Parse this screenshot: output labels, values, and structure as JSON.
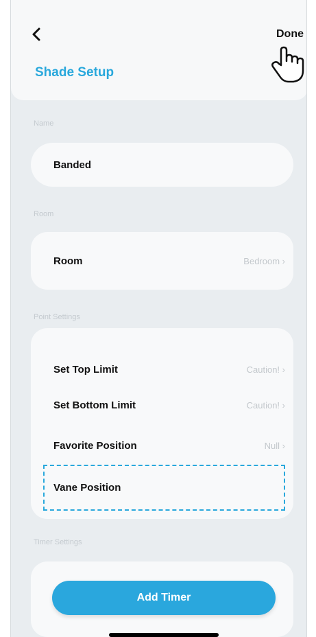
{
  "header": {
    "title": "Shade Setup",
    "done_label": "Done"
  },
  "sections": {
    "name_label": "Name",
    "room_label": "Room",
    "point_settings_label": "Point Settings",
    "timer_settings_label": "Timer Settings"
  },
  "name_field": {
    "value": "Banded"
  },
  "room_row": {
    "label": "Room",
    "value": "Bedroom"
  },
  "point_settings": [
    {
      "label": "Set Top Limit",
      "value": "Caution!"
    },
    {
      "label": "Set Bottom Limit",
      "value": "Caution!"
    },
    {
      "label": "Favorite Position",
      "value": "Null"
    },
    {
      "label": "Vane Position",
      "value": ""
    }
  ],
  "add_timer_label": "Add Timer",
  "icons": {
    "back": "chevron-left-icon",
    "cursor": "hand-pointer-icon",
    "chevron": "chevron-right-icon"
  },
  "colors": {
    "accent": "#29a8dc",
    "background": "#e9edf0",
    "card": "#f8f9fa"
  }
}
